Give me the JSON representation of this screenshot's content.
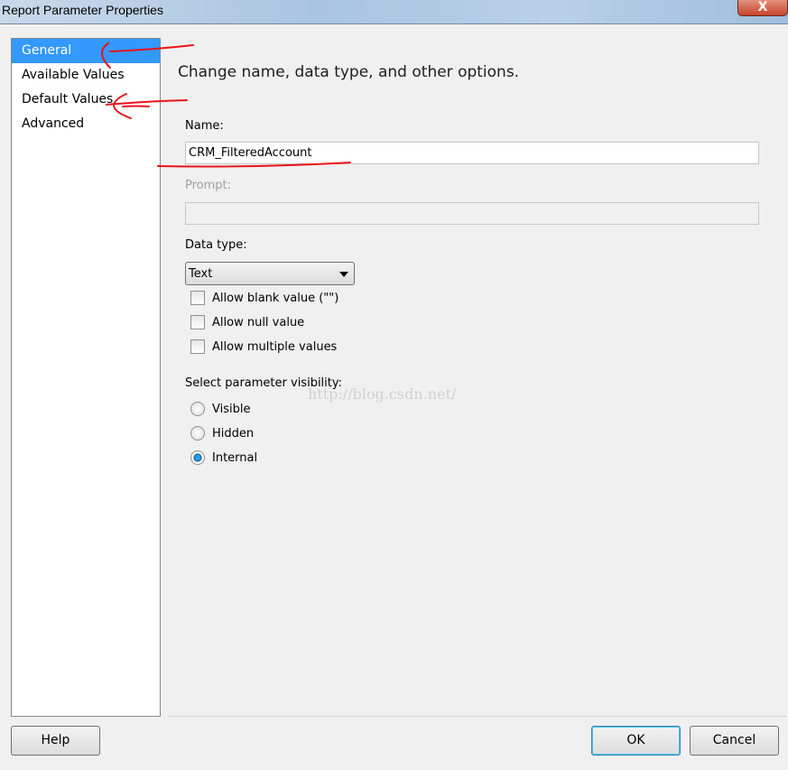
{
  "window": {
    "title": "Report Parameter Properties",
    "close_label": "X"
  },
  "sidebar": {
    "items": [
      {
        "label": "General",
        "selected": true
      },
      {
        "label": "Available Values"
      },
      {
        "label": "Default Values"
      },
      {
        "label": "Advanced"
      }
    ]
  },
  "main": {
    "heading": "Change name, data type, and other options.",
    "name_label": "Name:",
    "name_value": "CRM_FilteredAccount",
    "prompt_label": "Prompt:",
    "prompt_value": "",
    "datatype_label": "Data type:",
    "datatype_value": "Text",
    "checkboxes": [
      {
        "label": "Allow blank value (\"\")",
        "checked": false
      },
      {
        "label": "Allow null value",
        "checked": false
      },
      {
        "label": "Allow multiple values",
        "checked": false
      }
    ],
    "visibility_label": "Select parameter visibility:",
    "radios": [
      {
        "label": "Visible",
        "selected": false
      },
      {
        "label": "Hidden",
        "selected": false
      },
      {
        "label": "Internal",
        "selected": true
      }
    ]
  },
  "footer": {
    "help": "Help",
    "ok": "OK",
    "cancel": "Cancel"
  },
  "watermark": "http://blog.csdn.net/",
  "colors": {
    "selection": "#3399ff",
    "annotation": "#e8141b"
  }
}
